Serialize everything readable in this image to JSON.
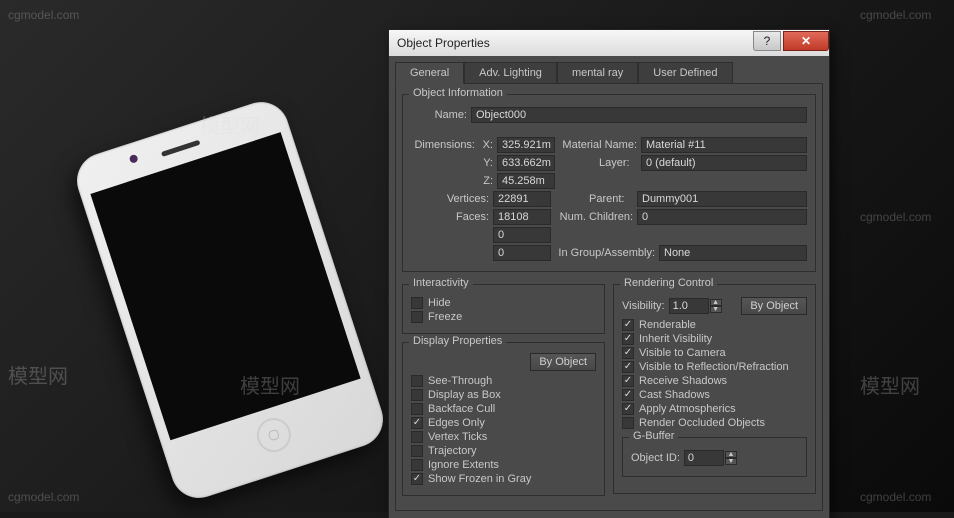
{
  "dialog": {
    "title": "Object Properties",
    "tabs": [
      "General",
      "Adv. Lighting",
      "mental ray",
      "User Defined"
    ]
  },
  "object_info": {
    "group": "Object Information",
    "name_label": "Name:",
    "name": "Object000",
    "dimensions_label": "Dimensions:",
    "x_label": "X:",
    "x": "325.921m",
    "y_label": "Y:",
    "y": "633.662m",
    "z_label": "Z:",
    "z": "45.258m",
    "material_label": "Material Name:",
    "material": "Material #11",
    "layer_label": "Layer:",
    "layer": "0 (default)",
    "vertices_label": "Vertices:",
    "vertices": "22891",
    "faces_label": "Faces:",
    "faces": "18108",
    "extra1": "0",
    "extra2": "0",
    "parent_label": "Parent:",
    "parent": "Dummy001",
    "children_label": "Num. Children:",
    "children": "0",
    "group_label": "In Group/Assembly:",
    "group_val": "None"
  },
  "interactivity": {
    "group": "Interactivity",
    "hide": "Hide",
    "freeze": "Freeze"
  },
  "display": {
    "group": "Display Properties",
    "by_object": "By Object",
    "see_through": "See-Through",
    "display_as_box": "Display as Box",
    "backface_cull": "Backface Cull",
    "edges_only": "Edges Only",
    "vertex_ticks": "Vertex Ticks",
    "trajectory": "Trajectory",
    "ignore_extents": "Ignore Extents",
    "show_frozen": "Show Frozen in Gray"
  },
  "rendering": {
    "group": "Rendering Control",
    "visibility_label": "Visibility:",
    "visibility": "1.0",
    "by_object": "By Object",
    "renderable": "Renderable",
    "inherit": "Inherit Visibility",
    "visible_camera": "Visible to Camera",
    "visible_refl": "Visible to Reflection/Refraction",
    "receive_shadows": "Receive Shadows",
    "cast_shadows": "Cast Shadows",
    "apply_atmos": "Apply Atmospherics",
    "render_occluded": "Render Occluded Objects"
  },
  "gbuffer": {
    "group": "G-Buffer",
    "object_id_label": "Object ID:",
    "object_id": "0"
  },
  "watermarks": {
    "text": "cgmodel.com",
    "logo": "模型网"
  }
}
